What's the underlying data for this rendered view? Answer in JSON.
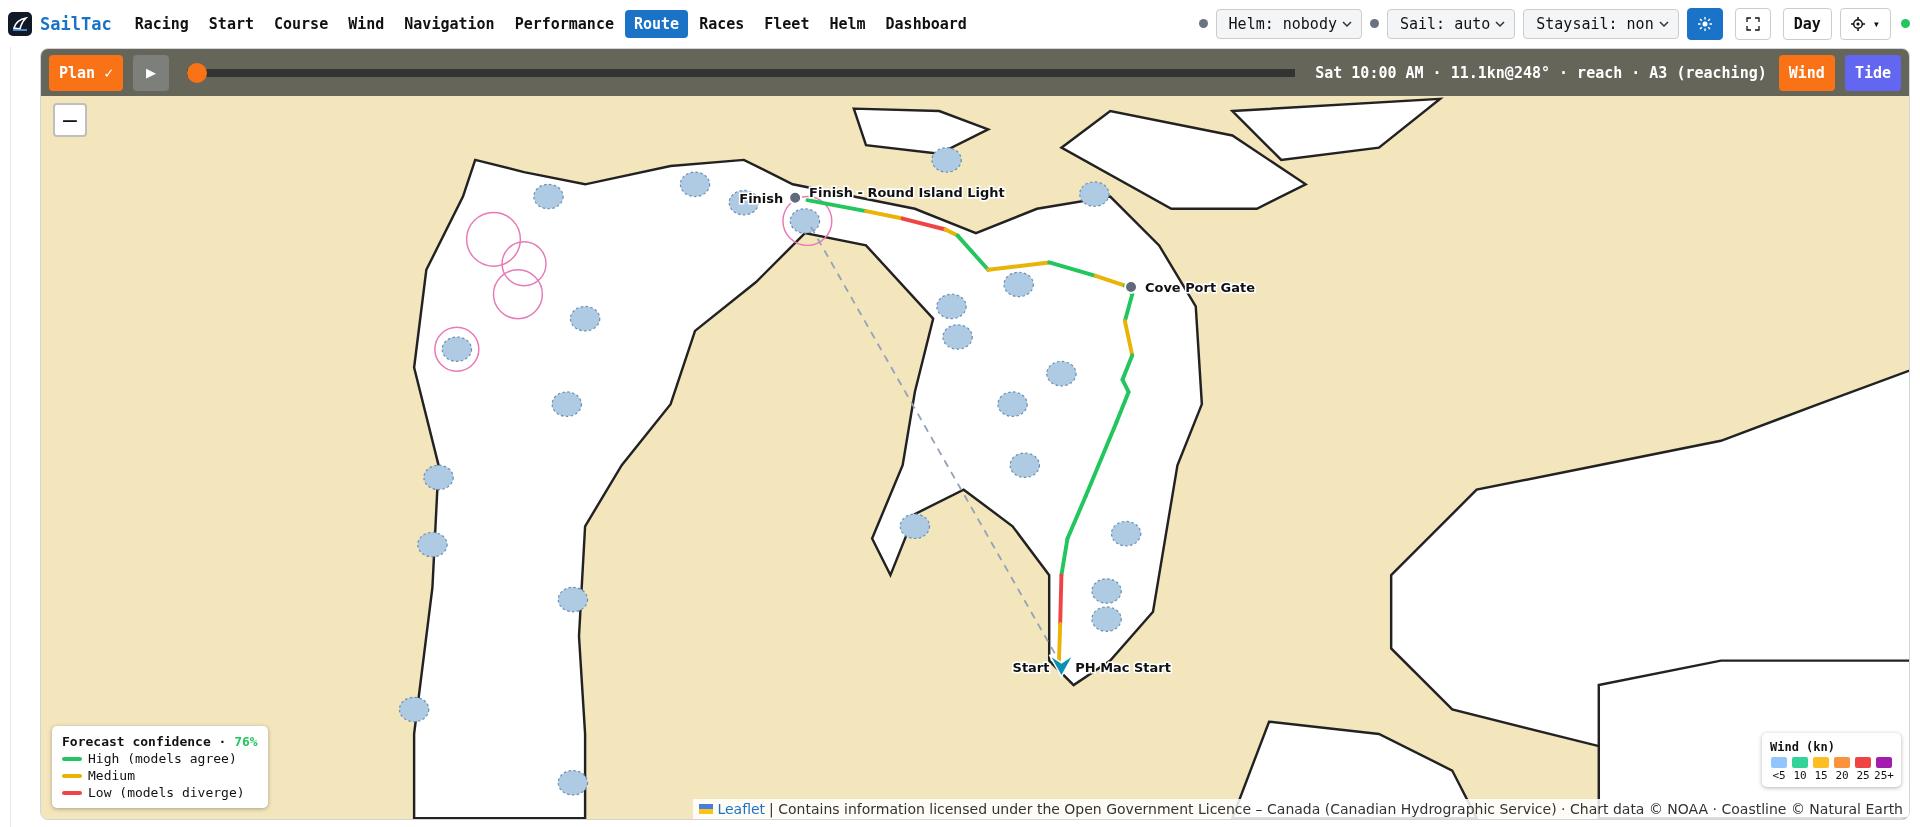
{
  "app": {
    "name": "SailTac"
  },
  "nav": [
    {
      "label": "Racing",
      "selected": false
    },
    {
      "label": "Start",
      "selected": false
    },
    {
      "label": "Course",
      "selected": false
    },
    {
      "label": "Wind",
      "selected": false
    },
    {
      "label": "Navigation",
      "selected": false
    },
    {
      "label": "Performance",
      "selected": false
    },
    {
      "label": "Route",
      "selected": true
    },
    {
      "label": "Races",
      "selected": false
    },
    {
      "label": "Fleet",
      "selected": false
    },
    {
      "label": "Helm",
      "selected": false
    },
    {
      "label": "Dashboard",
      "selected": false
    }
  ],
  "selects": [
    {
      "value": "Helm: nobody",
      "color": "#6b7280"
    },
    {
      "value": "Sail: auto",
      "color": "#6b7280"
    },
    {
      "value": "Staysail: non"
    }
  ],
  "toolbar_buttons": [
    {
      "kind": "sun",
      "selected": true
    },
    {
      "kind": "fullscreen",
      "selected": false
    },
    {
      "kind": "text",
      "label": "Day",
      "selected": false
    },
    {
      "kind": "gear",
      "label": "▾",
      "selected": false
    }
  ],
  "connection": {
    "color": "#22c55e"
  },
  "map": {
    "timeline": {
      "plan_button": "Plan ✓",
      "play_button": "▶",
      "level": 0,
      "status": "Sat 10:00 AM · 11.1kn@248° · reach · A3 (reaching)",
      "layers": [
        {
          "label": "Wind",
          "color": "#f97316"
        },
        {
          "label": "Tide",
          "color": "#6366f1"
        }
      ]
    },
    "zoom_out": "−",
    "markers": [
      {
        "kind": "waypoint",
        "label_left": "Finish",
        "label_right": "Finish - Round Island Light"
      },
      {
        "kind": "waypoint",
        "label_right": "Cove Port Gate"
      },
      {
        "kind": "start",
        "label_left": "Start",
        "label_right": "PH Mac Start"
      }
    ],
    "confidence_legend": {
      "title": "Forecast confidence · ",
      "value": {
        "text": "76%",
        "color": "#22c55e"
      },
      "items": [
        {
          "label": "High (models agree)",
          "color": "#22c55e"
        },
        {
          "label": "Medium",
          "color": "#eab308"
        },
        {
          "label": "Low (models diverge)",
          "color": "#ef4444"
        }
      ]
    },
    "wind_legend": {
      "title": "Wind (kn)",
      "items": [
        {
          "label": "<5",
          "color": "#93c5fd"
        },
        {
          "label": "10",
          "color": "#34d399"
        },
        {
          "label": "15",
          "color": "#fbbf24"
        },
        {
          "label": "20",
          "color": "#fb923c"
        },
        {
          "label": "25",
          "color": "#ef4444"
        },
        {
          "label": "25+",
          "color": "#a21caf"
        }
      ]
    },
    "attribution": {
      "link": "Leaflet",
      "text": "| Contains information licensed under the Open Government Licence – Canada (Canadian Hydrographic Service) · Chart data © NOAA · Coastline © Natural Earth"
    }
  }
}
